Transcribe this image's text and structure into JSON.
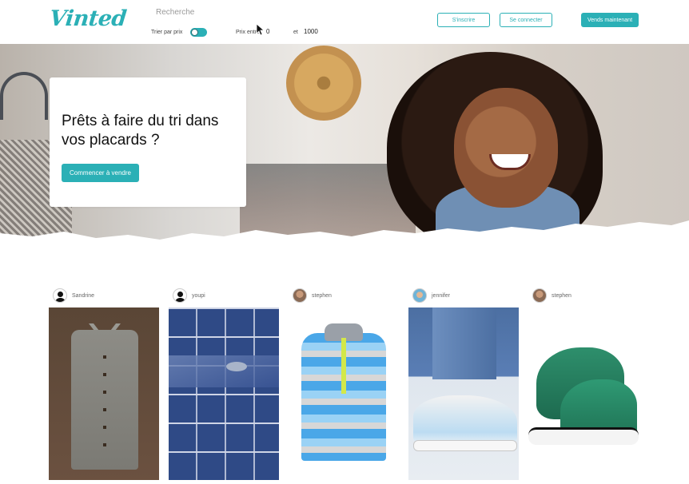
{
  "brand": {
    "logo": "Vinted",
    "accent_color": "#2bb0b6"
  },
  "header": {
    "search_placeholder": "Recherche",
    "sort_label": "Trier par prix",
    "sort_toggle_on": true,
    "price_between_label": "Prix entre",
    "price_min": "0",
    "price_and_label": "et",
    "price_max": "1000",
    "signup_label": "S'inscrire",
    "login_label": "Se connecter",
    "sell_now_label": "Vends maintenant"
  },
  "hero": {
    "title": "Prêts à faire du tri dans vos placards ?",
    "cta_label": "Commencer à vendre"
  },
  "listings": [
    {
      "username": "Sandrine",
      "avatar": "person-icon",
      "image": "sleeveless-shirt"
    },
    {
      "username": "youpi",
      "avatar": "person-icon",
      "image": "blue-tiles"
    },
    {
      "username": "stephen",
      "avatar": "user-photo",
      "image": "striped-sweater"
    },
    {
      "username": "jennifer",
      "avatar": "user-photo",
      "image": "white-sneakers"
    },
    {
      "username": "stephen",
      "avatar": "user-photo",
      "image": "green-converse"
    }
  ]
}
